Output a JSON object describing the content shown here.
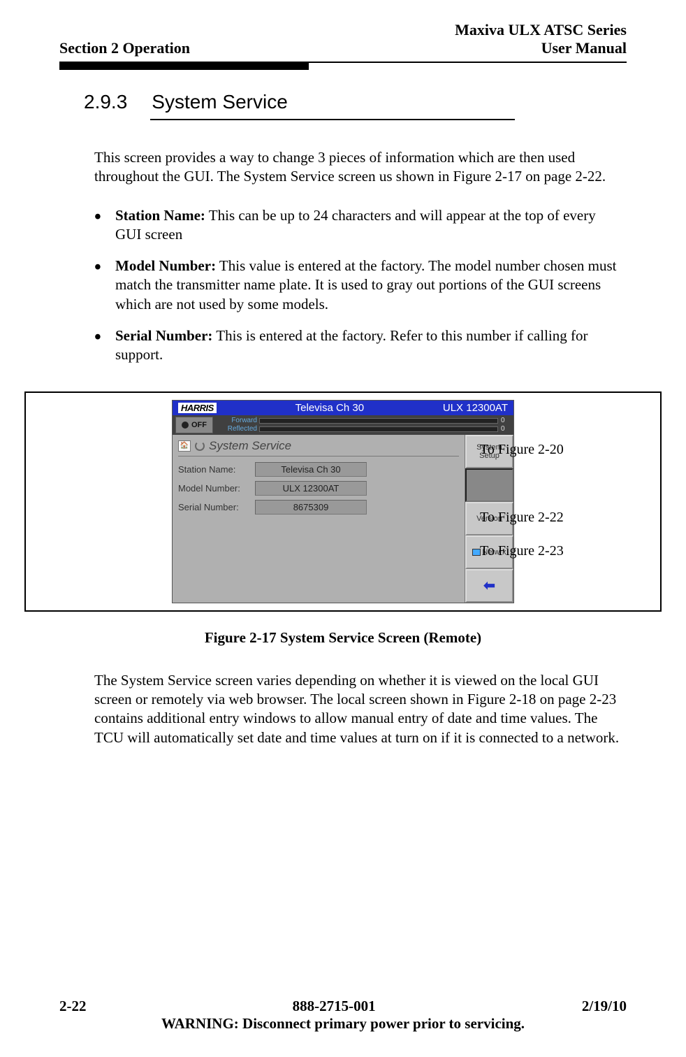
{
  "header": {
    "section": "Section 2 Operation",
    "series": "Maxiva ULX ATSC Series",
    "manual": "User Manual"
  },
  "heading": {
    "number": "2.9.3",
    "title": "System Service"
  },
  "intro": "This screen provides a way to change 3 pieces of information which are then used throughout the GUI. The System Service screen us shown in Figure 2-17 on page 2-22.",
  "bullets": [
    {
      "label": "Station Name:",
      "text": " This can be up to 24 characters and will appear at the top of every GUI screen"
    },
    {
      "label": "Model Number:",
      "text": " This value is entered at the factory. The model number chosen must match the transmitter name plate. It is used to gray out portions of the GUI screens which are not used by some models."
    },
    {
      "label": "Serial Number:",
      "text": " This is entered at the factory. Refer to this number if calling for support."
    }
  ],
  "gui": {
    "logo": "HARRIS",
    "title_center": "Televisa Ch 30",
    "title_model": "ULX 12300AT",
    "off": "OFF",
    "meters": {
      "forward": {
        "label": "Forward",
        "value": "0"
      },
      "reflected": {
        "label": "Reflected",
        "value": "0"
      }
    },
    "breadcrumb": "System Service",
    "fields": {
      "station_name": {
        "label": "Station Name:",
        "value": "Televisa Ch 30"
      },
      "model_number": {
        "label": "Model Number:",
        "value": "ULX 12300AT"
      },
      "serial_number": {
        "label": "Serial Number:",
        "value": "8675309"
      }
    },
    "sidebar": {
      "system_setup": "System\nSetup",
      "version": "Version",
      "netwrk": "Netwrk"
    }
  },
  "annotations": {
    "a1": "To Figure 2-20",
    "a2": "To Figure 2-22",
    "a3": "To Figure 2-23"
  },
  "figure_caption": "Figure 2-17  System Service Screen (Remote)",
  "body_after": "The System Service screen varies depending on whether it is viewed on  the local GUI screen or remotely via web browser. The local screen shown in Figure 2-18 on page 2-23 contains additional entry windows to allow manual entry of date and time values. The TCU will automatically set date and time values at turn on if it is connected to a network.",
  "footer": {
    "page": "2-22",
    "docnum": "888-2715-001",
    "date": "2/19/10",
    "warning": "WARNING: Disconnect primary power prior to servicing."
  }
}
